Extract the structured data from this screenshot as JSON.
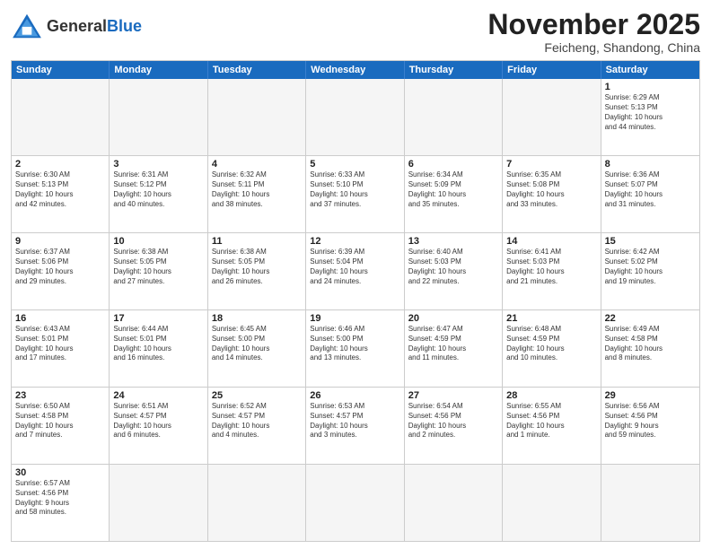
{
  "header": {
    "logo_general": "General",
    "logo_blue": "Blue",
    "month_title": "November 2025",
    "subtitle": "Feicheng, Shandong, China"
  },
  "days_of_week": [
    "Sunday",
    "Monday",
    "Tuesday",
    "Wednesday",
    "Thursday",
    "Friday",
    "Saturday"
  ],
  "weeks": [
    [
      {
        "day": "",
        "empty": true
      },
      {
        "day": "",
        "empty": true
      },
      {
        "day": "",
        "empty": true
      },
      {
        "day": "",
        "empty": true
      },
      {
        "day": "",
        "empty": true
      },
      {
        "day": "",
        "empty": true
      },
      {
        "day": "1",
        "text": "Sunrise: 6:29 AM\nSunset: 5:13 PM\nDaylight: 10 hours\nand 44 minutes."
      }
    ],
    [
      {
        "day": "2",
        "text": "Sunrise: 6:30 AM\nSunset: 5:13 PM\nDaylight: 10 hours\nand 42 minutes."
      },
      {
        "day": "3",
        "text": "Sunrise: 6:31 AM\nSunset: 5:12 PM\nDaylight: 10 hours\nand 40 minutes."
      },
      {
        "day": "4",
        "text": "Sunrise: 6:32 AM\nSunset: 5:11 PM\nDaylight: 10 hours\nand 38 minutes."
      },
      {
        "day": "5",
        "text": "Sunrise: 6:33 AM\nSunset: 5:10 PM\nDaylight: 10 hours\nand 37 minutes."
      },
      {
        "day": "6",
        "text": "Sunrise: 6:34 AM\nSunset: 5:09 PM\nDaylight: 10 hours\nand 35 minutes."
      },
      {
        "day": "7",
        "text": "Sunrise: 6:35 AM\nSunset: 5:08 PM\nDaylight: 10 hours\nand 33 minutes."
      },
      {
        "day": "8",
        "text": "Sunrise: 6:36 AM\nSunset: 5:07 PM\nDaylight: 10 hours\nand 31 minutes."
      }
    ],
    [
      {
        "day": "9",
        "text": "Sunrise: 6:37 AM\nSunset: 5:06 PM\nDaylight: 10 hours\nand 29 minutes."
      },
      {
        "day": "10",
        "text": "Sunrise: 6:38 AM\nSunset: 5:05 PM\nDaylight: 10 hours\nand 27 minutes."
      },
      {
        "day": "11",
        "text": "Sunrise: 6:38 AM\nSunset: 5:05 PM\nDaylight: 10 hours\nand 26 minutes."
      },
      {
        "day": "12",
        "text": "Sunrise: 6:39 AM\nSunset: 5:04 PM\nDaylight: 10 hours\nand 24 minutes."
      },
      {
        "day": "13",
        "text": "Sunrise: 6:40 AM\nSunset: 5:03 PM\nDaylight: 10 hours\nand 22 minutes."
      },
      {
        "day": "14",
        "text": "Sunrise: 6:41 AM\nSunset: 5:03 PM\nDaylight: 10 hours\nand 21 minutes."
      },
      {
        "day": "15",
        "text": "Sunrise: 6:42 AM\nSunset: 5:02 PM\nDaylight: 10 hours\nand 19 minutes."
      }
    ],
    [
      {
        "day": "16",
        "text": "Sunrise: 6:43 AM\nSunset: 5:01 PM\nDaylight: 10 hours\nand 17 minutes."
      },
      {
        "day": "17",
        "text": "Sunrise: 6:44 AM\nSunset: 5:01 PM\nDaylight: 10 hours\nand 16 minutes."
      },
      {
        "day": "18",
        "text": "Sunrise: 6:45 AM\nSunset: 5:00 PM\nDaylight: 10 hours\nand 14 minutes."
      },
      {
        "day": "19",
        "text": "Sunrise: 6:46 AM\nSunset: 5:00 PM\nDaylight: 10 hours\nand 13 minutes."
      },
      {
        "day": "20",
        "text": "Sunrise: 6:47 AM\nSunset: 4:59 PM\nDaylight: 10 hours\nand 11 minutes."
      },
      {
        "day": "21",
        "text": "Sunrise: 6:48 AM\nSunset: 4:59 PM\nDaylight: 10 hours\nand 10 minutes."
      },
      {
        "day": "22",
        "text": "Sunrise: 6:49 AM\nSunset: 4:58 PM\nDaylight: 10 hours\nand 8 minutes."
      }
    ],
    [
      {
        "day": "23",
        "text": "Sunrise: 6:50 AM\nSunset: 4:58 PM\nDaylight: 10 hours\nand 7 minutes."
      },
      {
        "day": "24",
        "text": "Sunrise: 6:51 AM\nSunset: 4:57 PM\nDaylight: 10 hours\nand 6 minutes."
      },
      {
        "day": "25",
        "text": "Sunrise: 6:52 AM\nSunset: 4:57 PM\nDaylight: 10 hours\nand 4 minutes."
      },
      {
        "day": "26",
        "text": "Sunrise: 6:53 AM\nSunset: 4:57 PM\nDaylight: 10 hours\nand 3 minutes."
      },
      {
        "day": "27",
        "text": "Sunrise: 6:54 AM\nSunset: 4:56 PM\nDaylight: 10 hours\nand 2 minutes."
      },
      {
        "day": "28",
        "text": "Sunrise: 6:55 AM\nSunset: 4:56 PM\nDaylight: 10 hours\nand 1 minute."
      },
      {
        "day": "29",
        "text": "Sunrise: 6:56 AM\nSunset: 4:56 PM\nDaylight: 9 hours\nand 59 minutes."
      }
    ],
    [
      {
        "day": "30",
        "text": "Sunrise: 6:57 AM\nSunset: 4:56 PM\nDaylight: 9 hours\nand 58 minutes."
      },
      {
        "day": "",
        "empty": true
      },
      {
        "day": "",
        "empty": true
      },
      {
        "day": "",
        "empty": true
      },
      {
        "day": "",
        "empty": true
      },
      {
        "day": "",
        "empty": true
      },
      {
        "day": "",
        "empty": true
      }
    ]
  ]
}
